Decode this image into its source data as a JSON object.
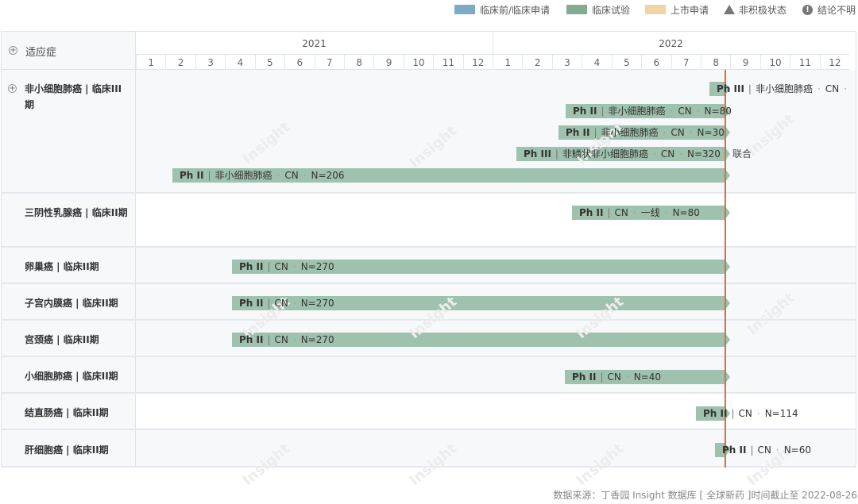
{
  "legend": [
    {
      "label": "临床前/临床申请",
      "color": "#7eaac6",
      "icon": "swatch"
    },
    {
      "label": "临床试验",
      "color": "#82ab92",
      "icon": "swatch"
    },
    {
      "label": "上市申请",
      "color": "#efd4a6",
      "icon": "swatch"
    },
    {
      "label": "非积极状态",
      "color": "#777777",
      "icon": "triangle-icon"
    },
    {
      "label": "结论不明",
      "color": "#777777",
      "icon": "info-icon"
    }
  ],
  "header": {
    "indication_label": "适应症",
    "expand_glyph": "+"
  },
  "timeline": {
    "years": [
      "2021",
      "2022"
    ],
    "months": [
      "1",
      "2",
      "3",
      "4",
      "5",
      "6",
      "7",
      "8",
      "9",
      "10",
      "11",
      "12",
      "1",
      "2",
      "3",
      "4",
      "5",
      "6",
      "7",
      "8",
      "9",
      "10",
      "11",
      "12"
    ],
    "today_line_color": "#e06a3b"
  },
  "rows": [
    {
      "label": "非小细胞肺癌 | 临床III期",
      "bars": [
        {
          "phase": "Ph III",
          "parts": [
            "非小细胞肺癌",
            "CN",
            ""
          ],
          "tail": ""
        },
        {
          "phase": "Ph II",
          "parts": [
            "非小细胞肺癌",
            "CN",
            "N=80"
          ],
          "tail": ""
        },
        {
          "phase": "Ph II",
          "parts": [
            "非小细胞肺癌",
            "CN",
            "N=30"
          ],
          "tail": ""
        },
        {
          "phase": "Ph III",
          "parts": [
            "非鳞状非小细胞肺癌",
            "CN",
            "N=320"
          ],
          "tail": "联合"
        },
        {
          "phase": "Ph II",
          "parts": [
            "非小细胞肺癌",
            "CN",
            "N=206"
          ],
          "tail": ""
        }
      ]
    },
    {
      "label": "三阴性乳腺癌 | 临床II期",
      "bars": [
        {
          "phase": "Ph II",
          "parts": [
            "CN",
            "一线",
            "N=80"
          ],
          "tail": ""
        }
      ]
    },
    {
      "label": "卵巢癌 | 临床II期",
      "bars": [
        {
          "phase": "Ph II",
          "parts": [
            "CN",
            "N=270"
          ],
          "tail": ""
        }
      ]
    },
    {
      "label": "子宫内膜癌 | 临床II期",
      "bars": [
        {
          "phase": "Ph II",
          "parts": [
            "CN",
            "N=270"
          ],
          "tail": ""
        }
      ]
    },
    {
      "label": "宫颈癌 | 临床II期",
      "bars": [
        {
          "phase": "Ph II",
          "parts": [
            "CN",
            "N=270"
          ],
          "tail": ""
        }
      ]
    },
    {
      "label": "小细胞肺癌 | 临床II期",
      "bars": [
        {
          "phase": "Ph II",
          "parts": [
            "CN",
            "N=40"
          ],
          "tail": ""
        }
      ]
    },
    {
      "label": "结直肠癌 | 临床II期",
      "bars": [
        {
          "phase": "Ph II",
          "parts": [
            "CN",
            "N=114"
          ],
          "tail": ""
        }
      ]
    },
    {
      "label": "肝细胞癌 | 临床II期",
      "bars": [
        {
          "phase": "Ph II",
          "parts": [
            "CN",
            "N=60"
          ],
          "tail": ""
        }
      ]
    }
  ],
  "watermark": "Insight",
  "footer": "数据来源：丁香园 Insight 数据库 [ 全球新药 ]时间截止至 2022-08-26"
}
